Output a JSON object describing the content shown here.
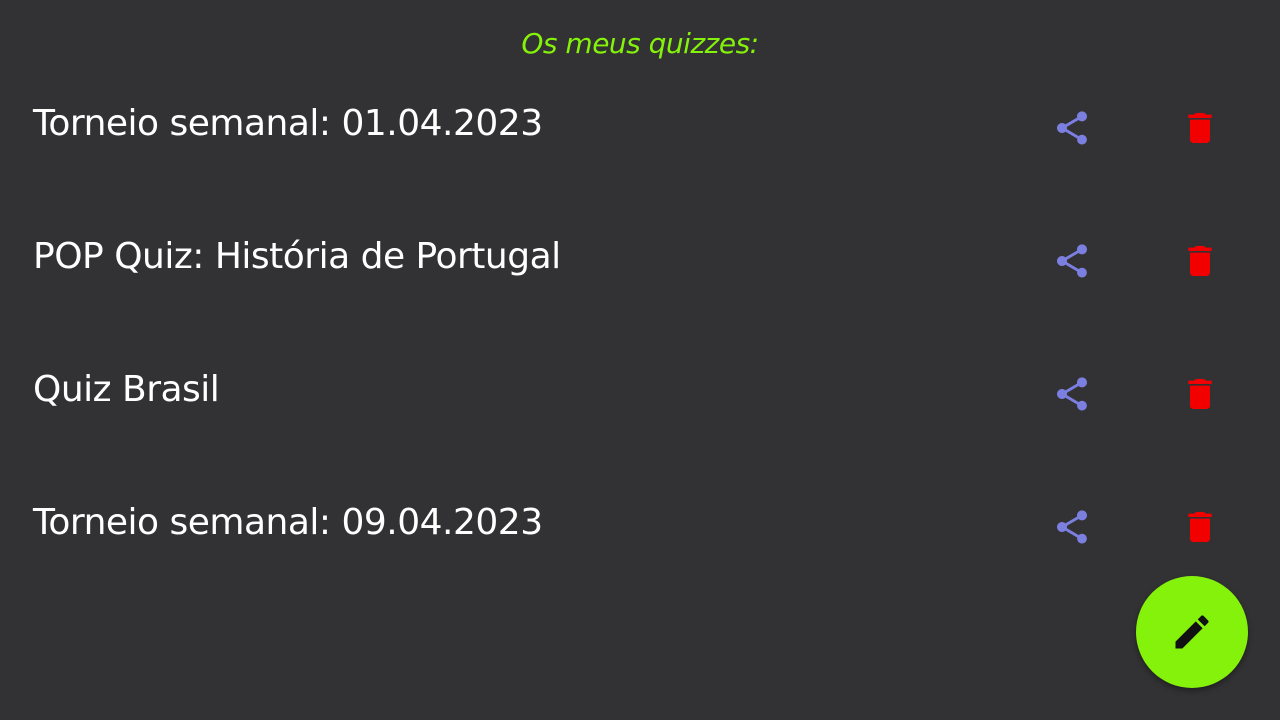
{
  "header": {
    "title": "Os meus quizzes:"
  },
  "colors": {
    "background": "#323133",
    "accent": "#84f20a",
    "share": "#7b7fe0",
    "delete": "#f20000",
    "text": "#ffffff"
  },
  "quizzes": [
    {
      "title": "Torneio semanal: 01.04.2023",
      "share_icon": "share-icon",
      "delete_icon": "trash-icon"
    },
    {
      "title": "POP Quiz: História de Portugal",
      "share_icon": "share-icon",
      "delete_icon": "trash-icon"
    },
    {
      "title": "Quiz Brasil",
      "share_icon": "share-icon",
      "delete_icon": "trash-icon"
    },
    {
      "title": "Torneio semanal: 09.04.2023",
      "share_icon": "share-icon",
      "delete_icon": "trash-icon"
    }
  ],
  "fab": {
    "icon": "pencil-icon"
  }
}
